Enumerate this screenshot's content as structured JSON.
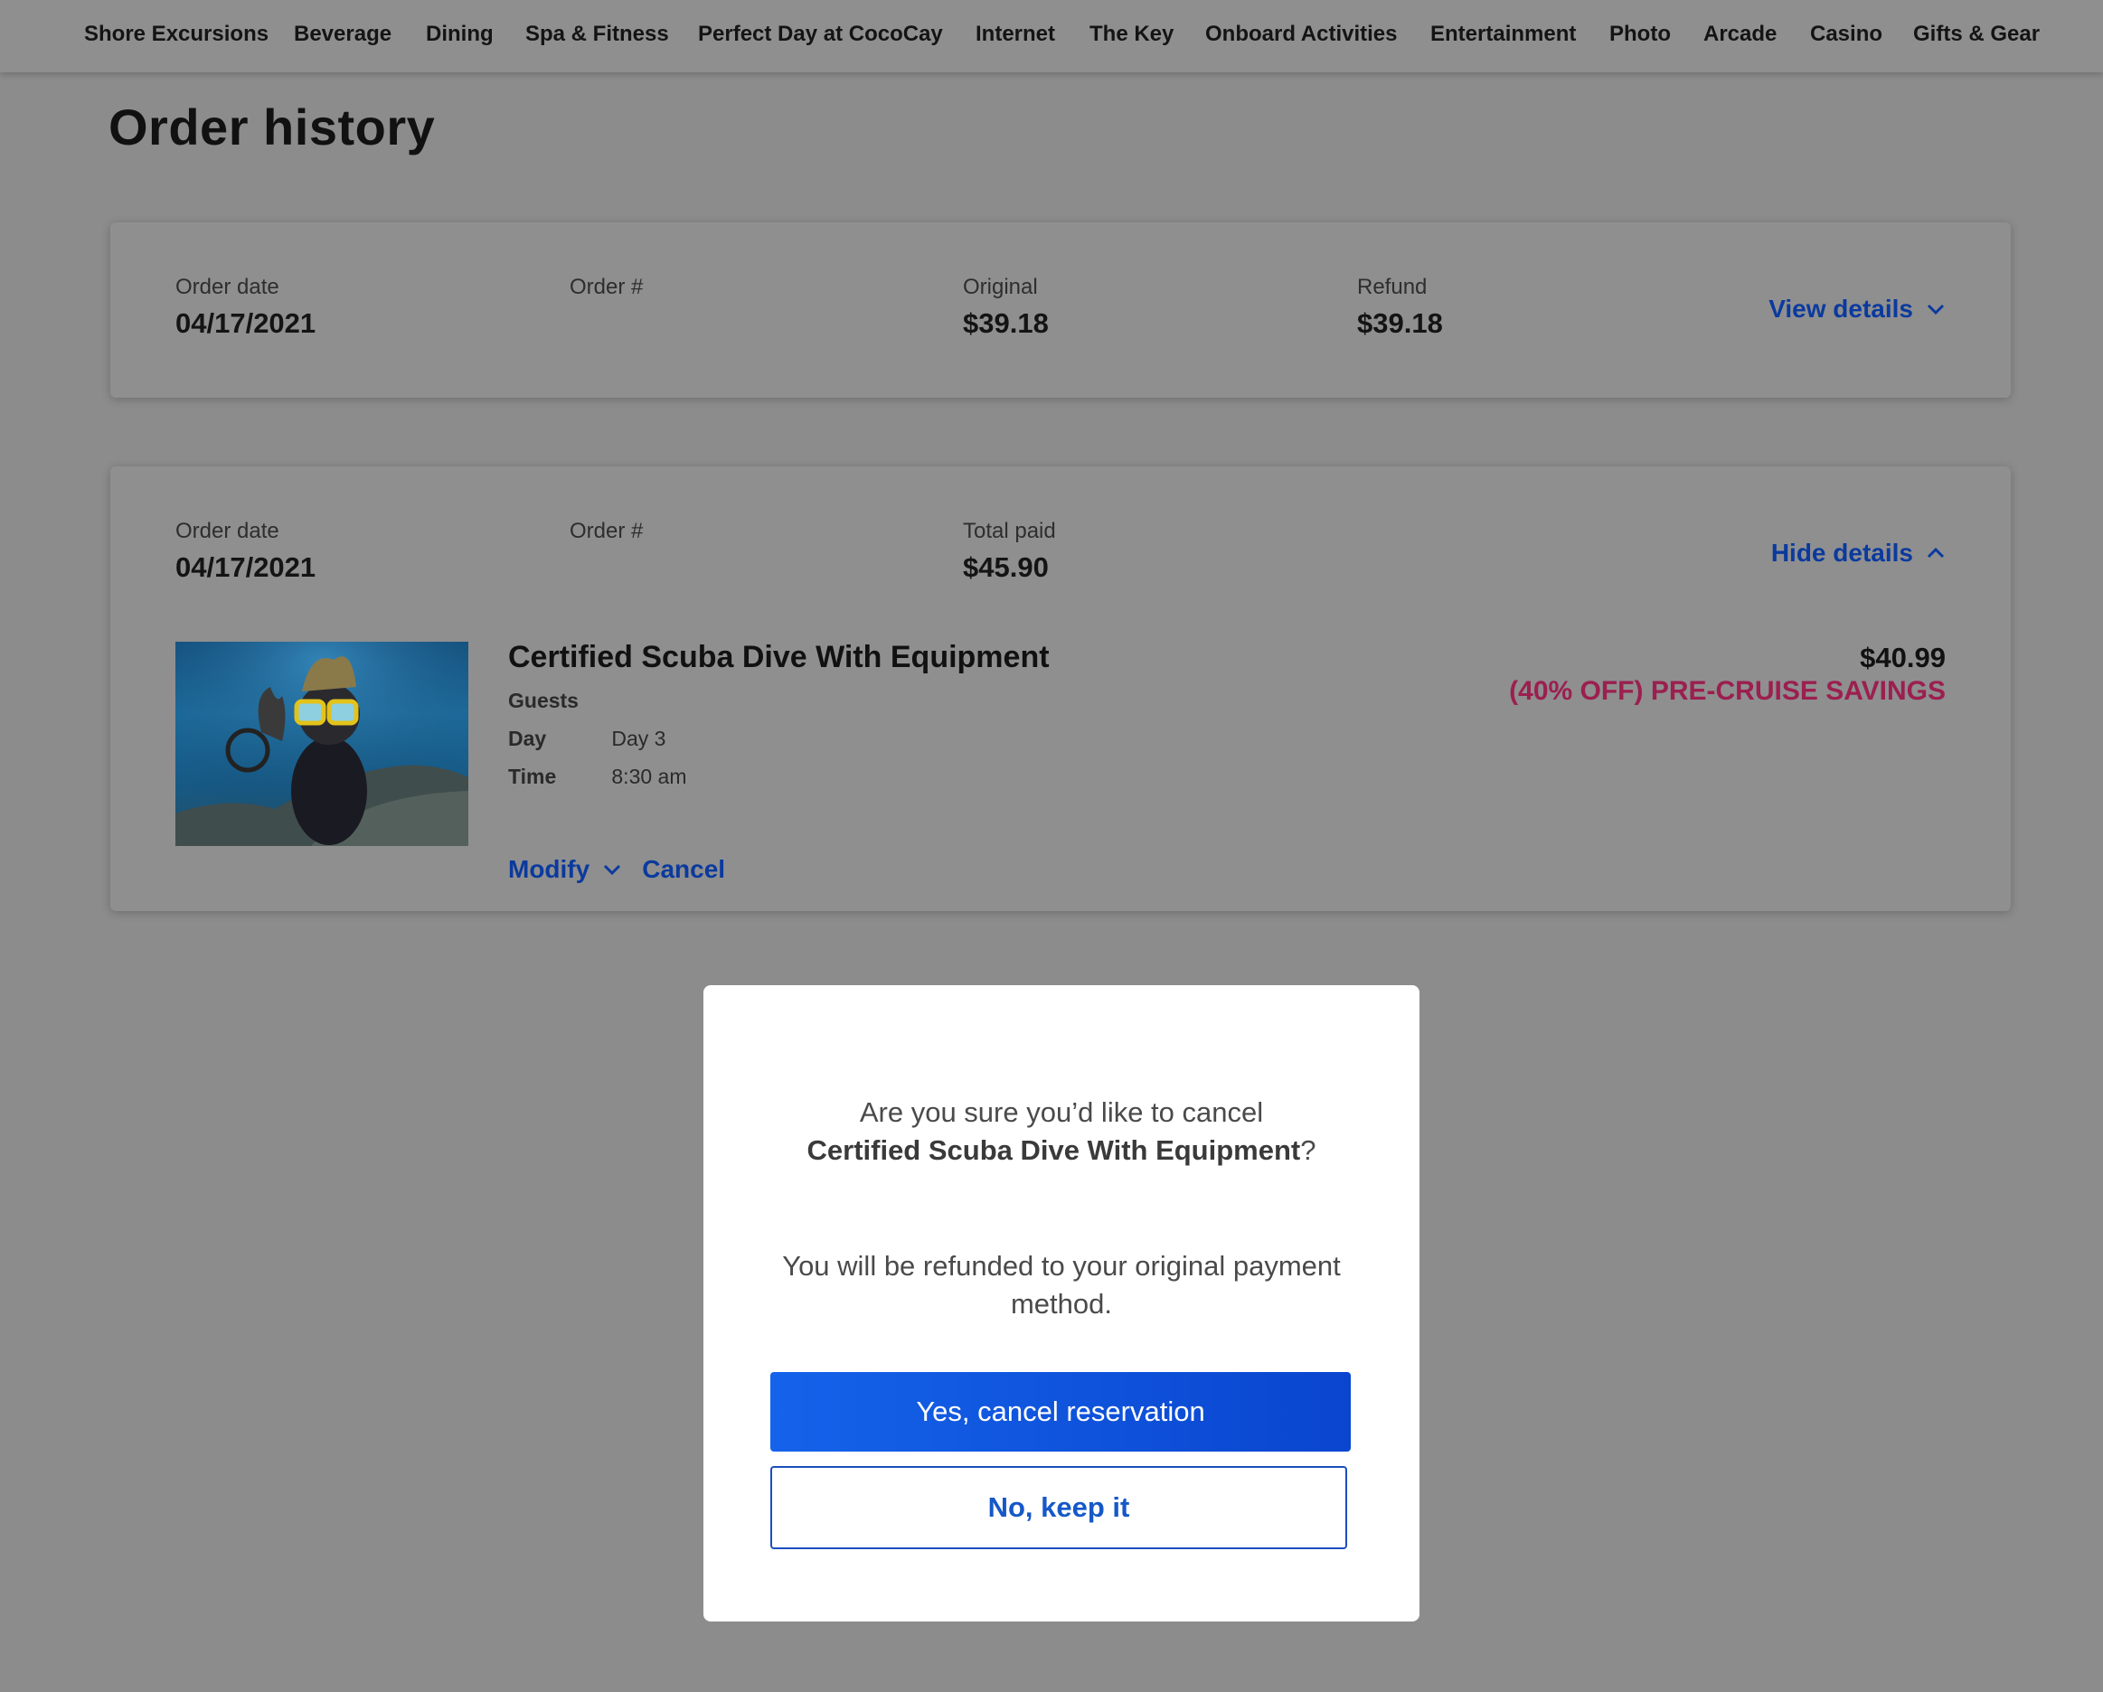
{
  "nav": {
    "items": [
      "Shore Excursions",
      "Beverage",
      "Dining",
      "Spa & Fitness",
      "Perfect Day at CocoCay",
      "Internet",
      "The Key",
      "Onboard Activities",
      "Entertainment",
      "Photo",
      "Arcade",
      "Casino",
      "Gifts & Gear"
    ]
  },
  "page": {
    "title": "Order history"
  },
  "orders": [
    {
      "date_label": "Order date",
      "date": "04/17/2021",
      "order_label": "Order #",
      "order_number": "",
      "original_label": "Original",
      "original": "$39.18",
      "refund_label": "Refund",
      "refund": "$39.18",
      "toggle": "View details"
    },
    {
      "date_label": "Order date",
      "date": "04/17/2021",
      "order_label": "Order #",
      "order_number": "",
      "total_label": "Total paid",
      "total": "$45.90",
      "toggle": "Hide details",
      "item": {
        "title": "Certified Scuba Dive With Equipment",
        "guests_label": "Guests",
        "day_label": "Day",
        "day": "Day 3",
        "time_label": "Time",
        "time": "8:30 am",
        "price": "$40.99",
        "savings": "(40% OFF)  PRE-CRUISE SAVINGS",
        "modify": "Modify",
        "cancel": "Cancel"
      }
    }
  ],
  "modal": {
    "question_prefix": "Are you sure you’d like to cancel",
    "question_item": "Certified Scuba Dive With Equipment",
    "question_suffix": "?",
    "info": "You will be refunded to your original payment method.",
    "confirm": "Yes, cancel reservation",
    "keep": "No, keep it"
  },
  "colors": {
    "link": "#0b3a9e",
    "savings": "#9b1f4f",
    "primary": "#1563ea"
  }
}
